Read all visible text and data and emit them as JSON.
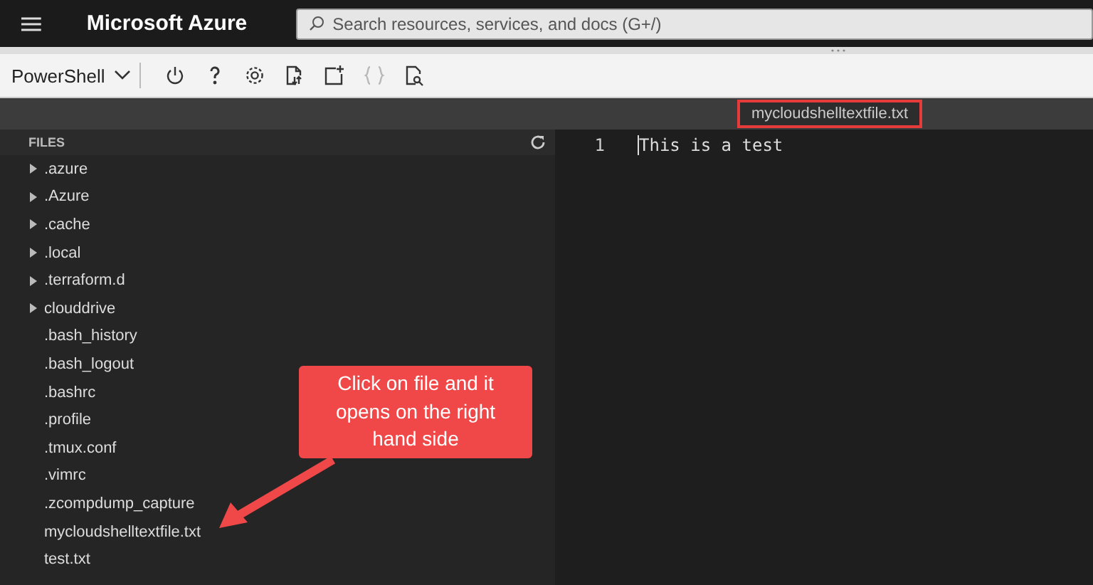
{
  "header": {
    "brand": "Microsoft Azure",
    "search": {
      "placeholder": "Search resources, services, and docs (G+/)"
    }
  },
  "toolbar": {
    "shell": "PowerShell",
    "buttons": [
      {
        "kind": "power",
        "disabled": false
      },
      {
        "kind": "help",
        "disabled": false
      },
      {
        "kind": "settings",
        "disabled": false
      },
      {
        "kind": "upload",
        "disabled": false
      },
      {
        "kind": "new",
        "disabled": false
      },
      {
        "kind": "braces",
        "disabled": true
      },
      {
        "kind": "preview",
        "disabled": false
      }
    ]
  },
  "editor_tab": {
    "label": "mycloudshelltextfile.txt"
  },
  "files": {
    "title": "FILES",
    "items": [
      {
        "name": ".azure",
        "kind": "folder",
        "expanded": false
      },
      {
        "name": ".Azure",
        "kind": "folder",
        "expanded": false
      },
      {
        "name": ".cache",
        "kind": "folder",
        "expanded": false
      },
      {
        "name": ".local",
        "kind": "folder",
        "expanded": false
      },
      {
        "name": ".terraform.d",
        "kind": "folder",
        "expanded": false
      },
      {
        "name": "clouddrive",
        "kind": "folder",
        "expanded": false
      },
      {
        "name": ".bash_history",
        "kind": "file"
      },
      {
        "name": ".bash_logout",
        "kind": "file"
      },
      {
        "name": ".bashrc",
        "kind": "file"
      },
      {
        "name": ".profile",
        "kind": "file"
      },
      {
        "name": ".tmux.conf",
        "kind": "file"
      },
      {
        "name": ".vimrc",
        "kind": "file"
      },
      {
        "name": ".zcompdump_capture",
        "kind": "file"
      },
      {
        "name": "mycloudshelltextfile.txt",
        "kind": "file"
      },
      {
        "name": "test.txt",
        "kind": "file"
      }
    ]
  },
  "editor": {
    "lines": [
      {
        "number": "1",
        "text": "This is a test"
      }
    ]
  },
  "annotation": {
    "text": "Click on file and it opens on the right hand side"
  }
}
